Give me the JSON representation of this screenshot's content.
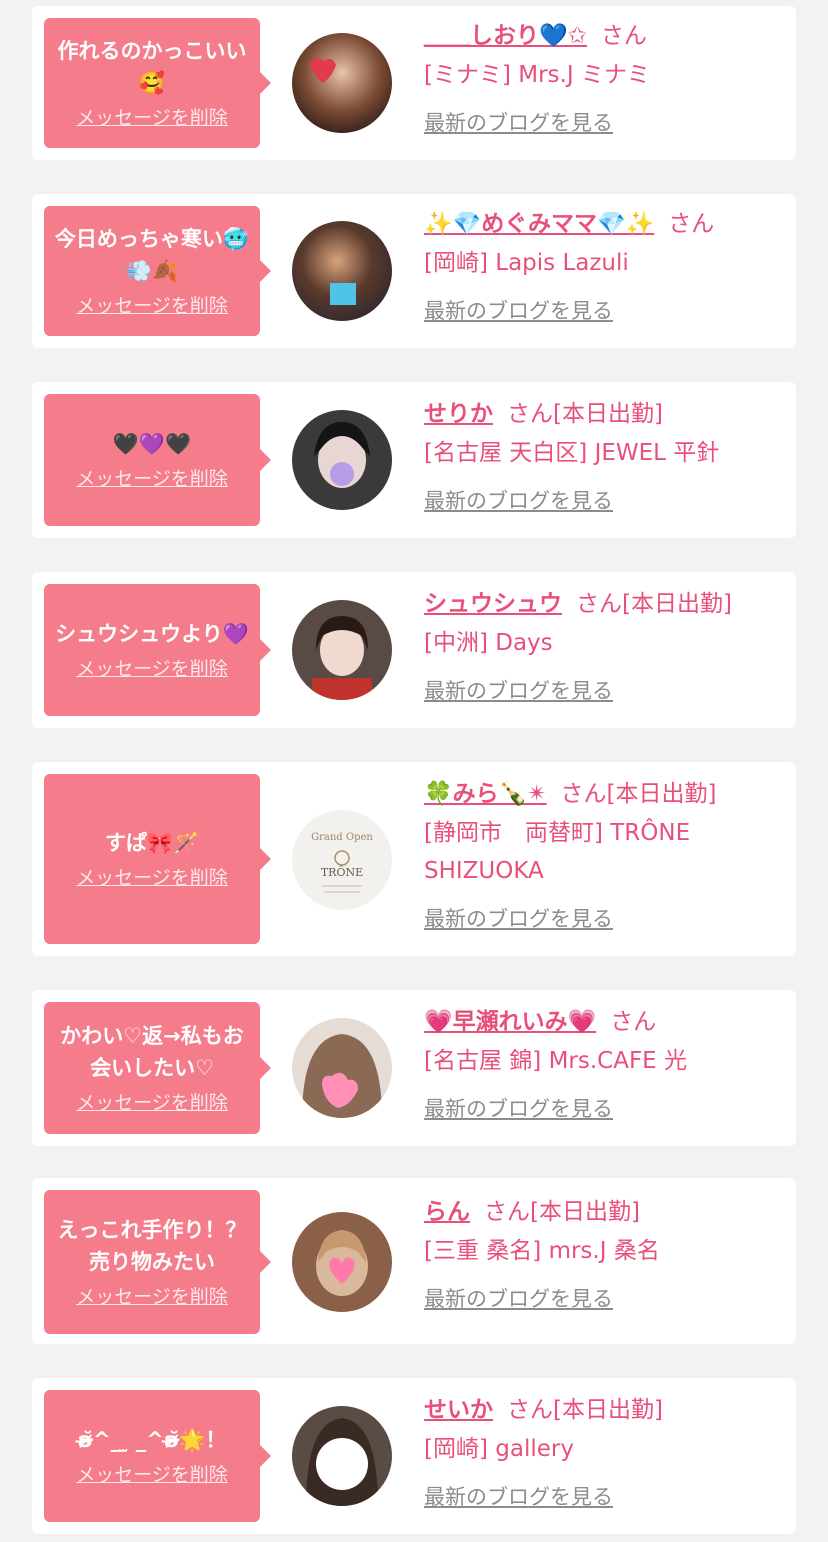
{
  "delete_label": "メッセージを削除",
  "san_label": "さん",
  "blog_label": "最新のブログを見る",
  "entries": [
    {
      "message": "作れるのかっこいい🥰",
      "name": "＿＿しおり💙✩",
      "tag": "",
      "shop": "[ミナミ] Mrs.J ミナミ",
      "avatar_icon": "profile-photo"
    },
    {
      "message": "今日めっちゃ寒い🥶💨🍂",
      "name": "✨💎めぐみママ💎✨",
      "tag": "",
      "shop": "[岡崎] Lapis Lazuli",
      "avatar_icon": "profile-photo"
    },
    {
      "message": "🖤💜🖤",
      "name": "せりか",
      "tag": "[本日出勤]",
      "shop": "[名古屋 天白区] JEWEL 平針",
      "avatar_icon": "profile-photo"
    },
    {
      "message": "シュウシュウより💜",
      "name": "シュウシュウ",
      "tag": "[本日出勤]",
      "shop": "[中洲] Days",
      "avatar_icon": "profile-photo"
    },
    {
      "message": "すぱ🎀🪄",
      "name": "🍀みら🍾✴",
      "tag": "[本日出勤]",
      "shop": "[静岡市　両替町] TRÔNE SHIZUOKA",
      "avatar_icon": "shop-logo"
    },
    {
      "message": "かわい♡返→私もお会いしたい♡",
      "name": "💗早瀬れいみ💗",
      "tag": "",
      "shop": "[名古屋 錦] Mrs.CAFE 光",
      "avatar_icon": "profile-photo"
    },
    {
      "message": "えっこれ手作り！？売り物みたい",
      "name": "らん",
      "tag": "[本日出勤]",
      "shop": "[三重 桑名] mrs.J 桑名",
      "avatar_icon": "profile-photo"
    },
    {
      "message": "ʚ̴̶̷̆^_ ̫ _^ʚ̴̶̷̆🌟！",
      "name": "せいか",
      "tag": "[本日出勤]",
      "shop": "[岡崎] gallery",
      "avatar_icon": "profile-photo"
    }
  ],
  "colors": {
    "background": "#f2f2f2",
    "bubble": "#f47c8b",
    "accent_pink": "#e8507a",
    "link_gray": "#8c8c8c"
  }
}
